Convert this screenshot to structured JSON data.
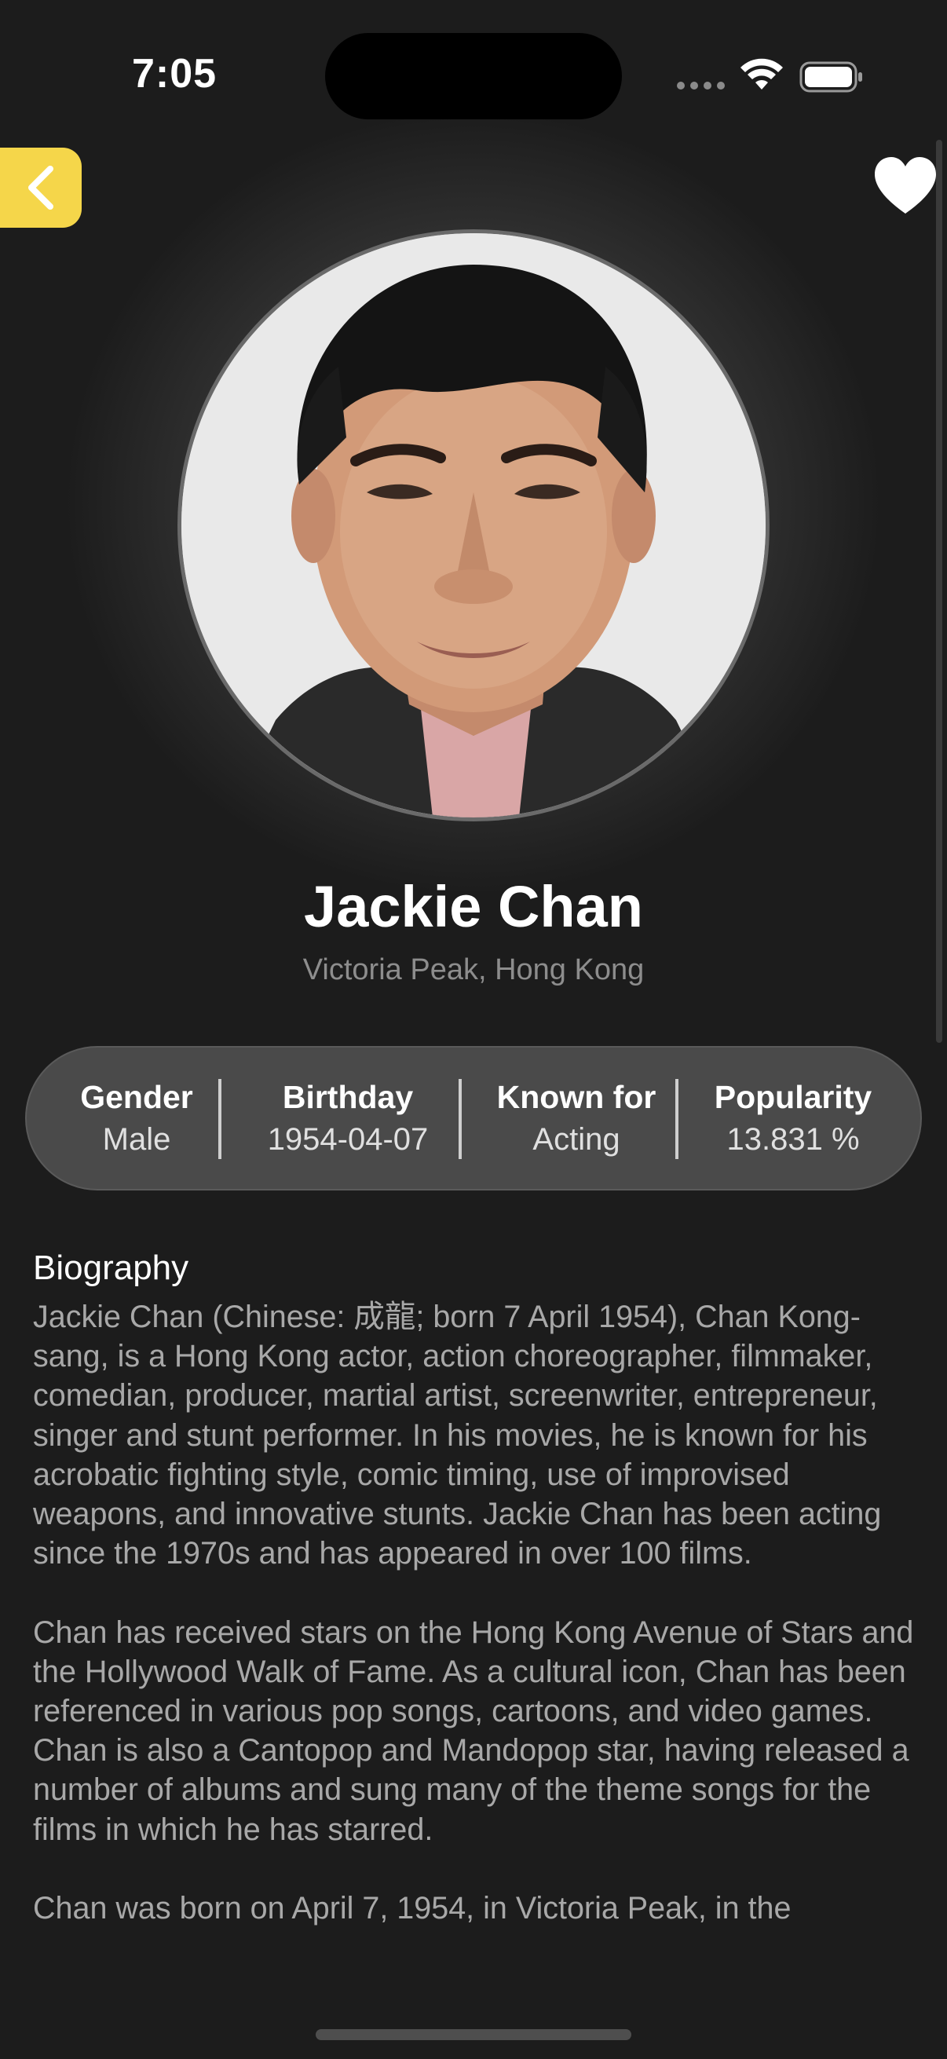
{
  "status_bar": {
    "time": "7:05"
  },
  "nav": {
    "back_icon": "chevron-left-icon",
    "favorite_icon": "heart-icon"
  },
  "colors": {
    "accent": "#f5d64a",
    "background": "#1c1c1c",
    "pill": "#4a4a4a",
    "muted_text": "#8d8d8d",
    "bio_text": "#a8a8a8"
  },
  "person": {
    "name": "Jackie Chan",
    "place_of_birth": "Victoria Peak, Hong Kong"
  },
  "info": {
    "gender_label": "Gender",
    "gender_value": "Male",
    "birthday_label": "Birthday",
    "birthday_value": "1954-04-07",
    "known_for_label": "Known for",
    "known_for_value": "Acting",
    "popularity_label": "Popularity",
    "popularity_value": "13.831 %"
  },
  "biography": {
    "title": "Biography",
    "text": "Jackie Chan (Chinese: 成龍; born 7 April 1954), Chan Kong-sang, is a Hong Kong actor, action choreographer, filmmaker, comedian, producer, martial artist, screenwriter, entrepreneur, singer and stunt performer. In his movies, he is known for his acrobatic fighting style, comic timing, use of improvised weapons, and innovative stunts. Jackie Chan has been acting since the 1970s and has appeared in over 100 films.\n\nChan has received stars on the Hong Kong Avenue of Stars and the Hollywood Walk of Fame. As a cultural icon, Chan has been referenced in various pop songs, cartoons, and video games. Chan is also a Cantopop and Mandopop star, having released a number of albums and sung many of the theme songs for the films in which he has starred.\n\nChan was born on April 7, 1954, in Victoria Peak, in the"
  }
}
